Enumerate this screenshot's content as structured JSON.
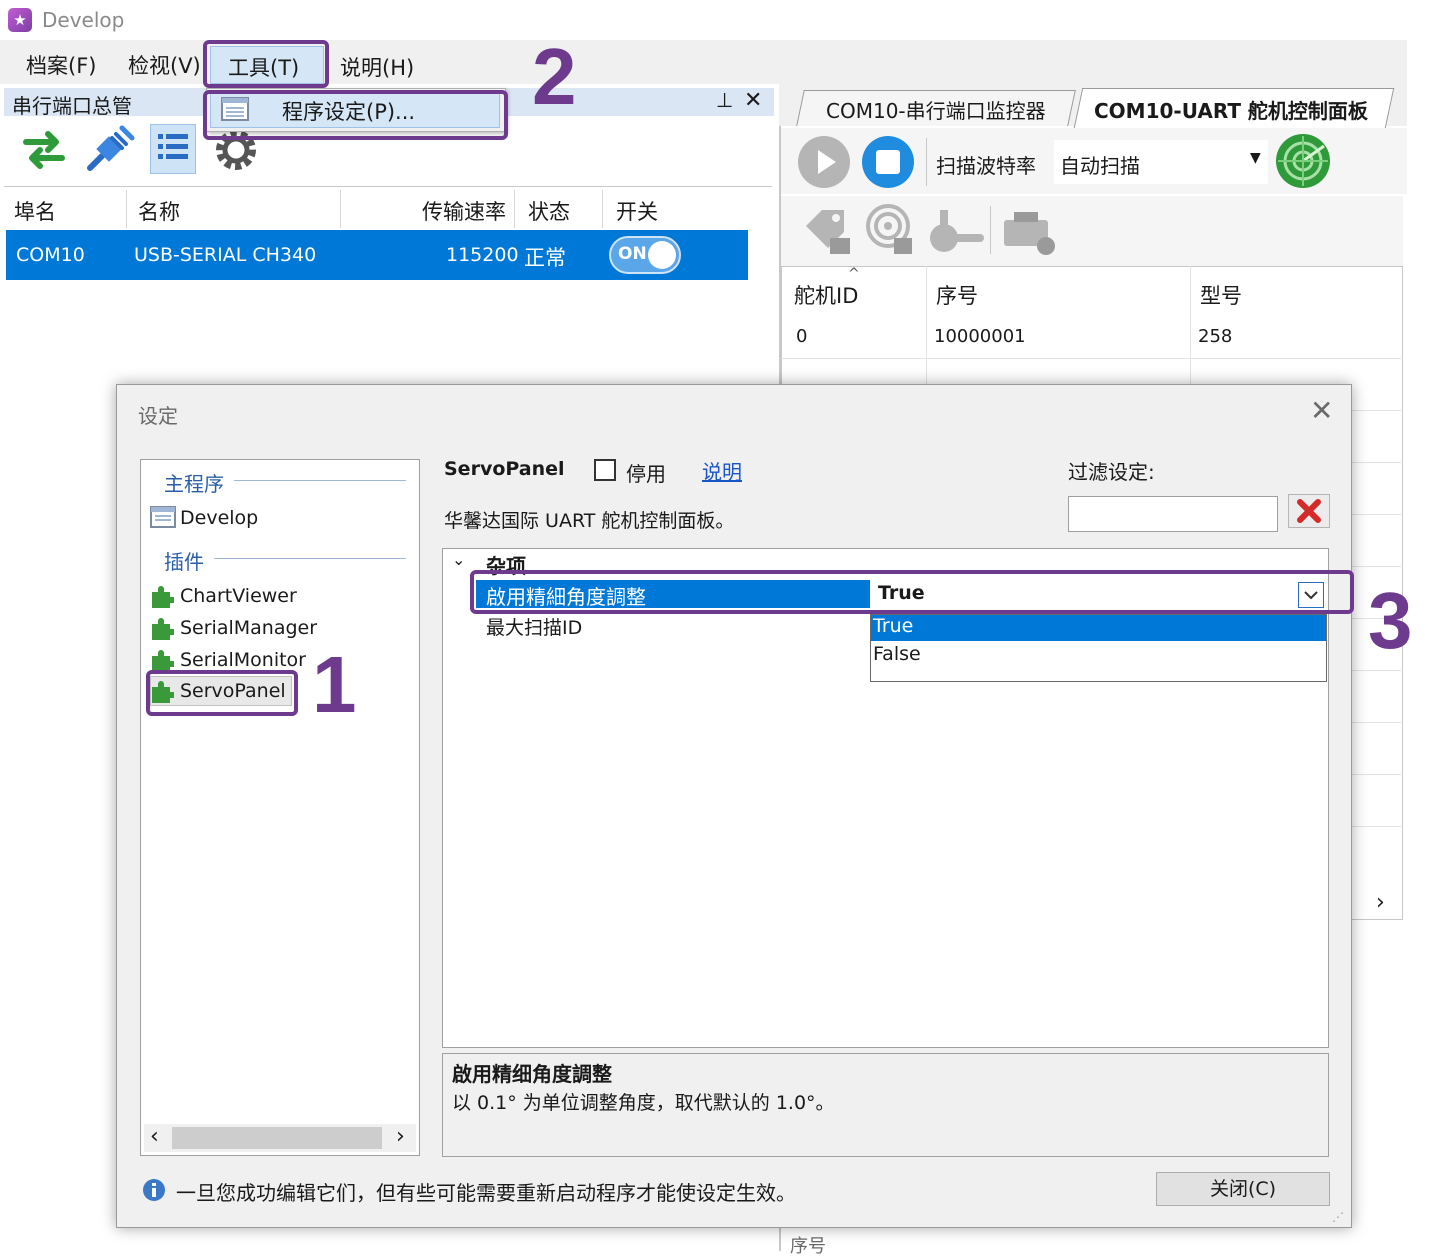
{
  "app": {
    "title": "Develop"
  },
  "menu": {
    "file": "档案(F)",
    "view": "检视(V)",
    "tools": "工具(T)",
    "help": "说明(H)"
  },
  "tools_dropdown": {
    "item": "程序设定(P)..."
  },
  "left_dock": {
    "title": "串行端口总管",
    "pin": "⊥",
    "close": "✕",
    "columns": [
      "埠名",
      "名称",
      "传输速率",
      "状态",
      "开关"
    ],
    "row": {
      "port": "COM10",
      "name": "USB-SERIAL CH340",
      "baud": "115200",
      "status": "正常",
      "switch": "ON"
    }
  },
  "right_dock": {
    "tabs": [
      "COM10-串行端口监控器",
      "COM10-UART 舵机控制面板"
    ],
    "scan_label": "扫描波特率",
    "scan_value": "自动扫描",
    "columns": [
      "舵机ID",
      "序号",
      "型号"
    ],
    "rows": [
      {
        "id": "0",
        "serial": "10000001",
        "model": "258"
      }
    ],
    "bottom_text": "序号"
  },
  "dialog": {
    "title": "设定",
    "tree": {
      "main_header": "主程序",
      "main_item": "Develop",
      "plugins_header": "插件",
      "plugins": [
        "ChartViewer",
        "SerialManager",
        "SerialMonitor",
        "ServoPanel"
      ]
    },
    "plugin_name": "ServoPanel",
    "disable_label": "停用",
    "help_link": "说明",
    "filter_label": "过滤设定:",
    "description": "华馨达国际 UART 舵机控制面板。",
    "category": "杂项",
    "properties": [
      {
        "name": "啟用精細角度調整",
        "value": "True"
      },
      {
        "name": "最大扫描ID",
        "value": ""
      }
    ],
    "dropdown_options": [
      "True",
      "False"
    ],
    "desc_title": "啟用精细角度調整",
    "desc_text": "以 0.1° 为单位调整角度，取代默认的 1.0°。",
    "footer_note": "一旦您成功编辑它们，但有些可能需要重新启动程序才能使设定生效。",
    "close_button": "关闭(C)"
  },
  "annotations": {
    "step1": "1",
    "step2": "2",
    "step3": "3",
    "color": "#6d3a8e"
  },
  "colors": {
    "selection": "#0078d7",
    "toggle": "#5aa6e9",
    "accent_purple": "#6d3a8e"
  }
}
